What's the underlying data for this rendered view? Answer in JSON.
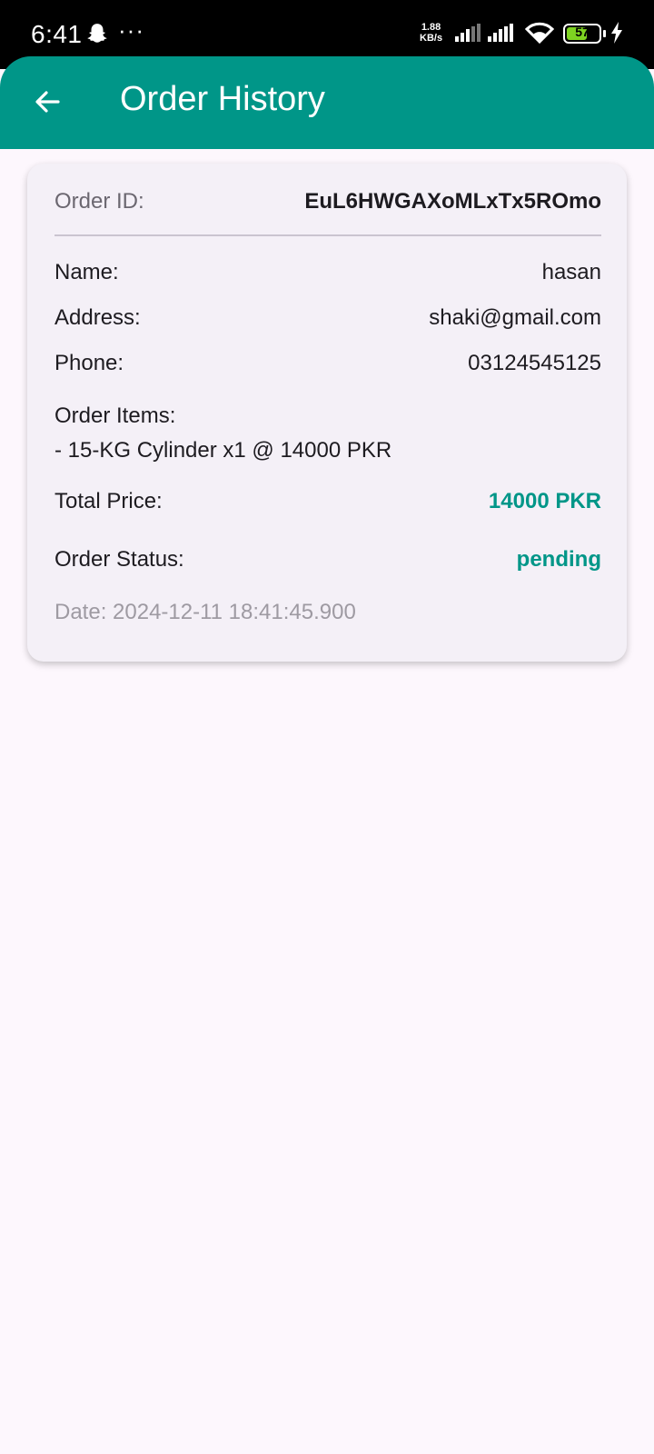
{
  "status_bar": {
    "time": "6:41",
    "dots": "···",
    "speed_value": "1.88",
    "speed_unit": "KB/s",
    "battery": "57",
    "icons": [
      "snapchat-ghost-icon",
      "signal-icon",
      "signal-icon",
      "wifi-icon",
      "battery-icon",
      "charging-bolt-icon"
    ]
  },
  "app_bar": {
    "title": "Order History",
    "back_icon": "arrow-left-icon",
    "color": "#009688"
  },
  "order": {
    "id_label": "Order ID:",
    "id_value": "EuL6HWGAXoMLxTx5ROmo",
    "name_label": "Name:",
    "name_value": "hasan",
    "address_label": "Address:",
    "address_value": "shaki@gmail.com",
    "phone_label": "Phone:",
    "phone_value": "03124545125",
    "items_label": "Order Items:",
    "items": [
      "- 15-KG Cylinder x1 @ 14000 PKR"
    ],
    "total_label": "Total Price:",
    "total_value": "14000 PKR",
    "status_label": "Order Status:",
    "status_value": "pending",
    "date": "Date: 2024-12-11 18:41:45.900",
    "accent_color": "#009688"
  }
}
